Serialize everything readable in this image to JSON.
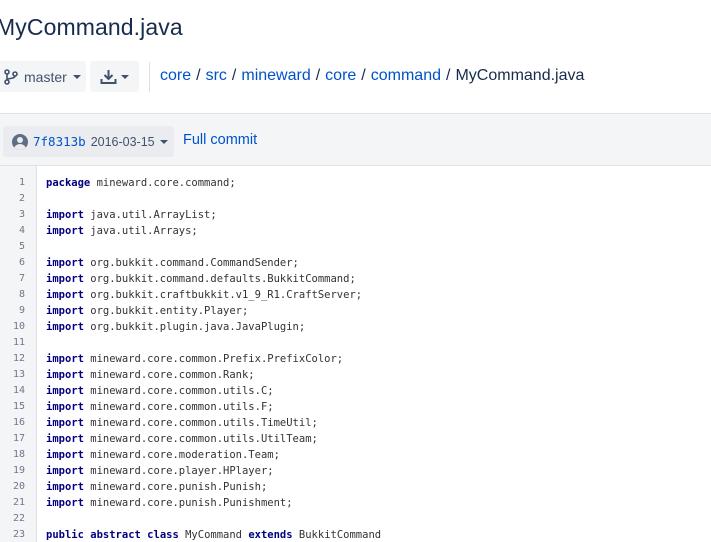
{
  "page": {
    "title": "MyCommand.java"
  },
  "toolbar": {
    "branch_label": "master",
    "branch_icon": "branch-icon",
    "download_icon": "download-icon"
  },
  "breadcrumb": {
    "parts": [
      "core",
      "src",
      "mineward",
      "core",
      "command"
    ],
    "current": "MyCommand.java"
  },
  "commit": {
    "hash": "7f8313b",
    "date": "2016-03-15",
    "full_commit_label": "Full commit"
  },
  "code": {
    "lines": [
      [
        {
          "t": "package",
          "k": 1
        },
        {
          "t": " mineward.core.command;"
        }
      ],
      [],
      [
        {
          "t": "import",
          "k": 1
        },
        {
          "t": " java.util.ArrayList;"
        }
      ],
      [
        {
          "t": "import",
          "k": 1
        },
        {
          "t": " java.util.Arrays;"
        }
      ],
      [],
      [
        {
          "t": "import",
          "k": 1
        },
        {
          "t": " org.bukkit.command.CommandSender;"
        }
      ],
      [
        {
          "t": "import",
          "k": 1
        },
        {
          "t": " org.bukkit.command.defaults.BukkitCommand;"
        }
      ],
      [
        {
          "t": "import",
          "k": 1
        },
        {
          "t": " org.bukkit.craftbukkit.v1_9_R1.CraftServer;"
        }
      ],
      [
        {
          "t": "import",
          "k": 1
        },
        {
          "t": " org.bukkit.entity.Player;"
        }
      ],
      [
        {
          "t": "import",
          "k": 1
        },
        {
          "t": " org.bukkit.plugin.java.JavaPlugin;"
        }
      ],
      [],
      [
        {
          "t": "import",
          "k": 1
        },
        {
          "t": " mineward.core.common.Prefix.PrefixColor;"
        }
      ],
      [
        {
          "t": "import",
          "k": 1
        },
        {
          "t": " mineward.core.common.Rank;"
        }
      ],
      [
        {
          "t": "import",
          "k": 1
        },
        {
          "t": " mineward.core.common.utils.C;"
        }
      ],
      [
        {
          "t": "import",
          "k": 1
        },
        {
          "t": " mineward.core.common.utils.F;"
        }
      ],
      [
        {
          "t": "import",
          "k": 1
        },
        {
          "t": " mineward.core.common.utils.TimeUtil;"
        }
      ],
      [
        {
          "t": "import",
          "k": 1
        },
        {
          "t": " mineward.core.common.utils.UtilTeam;"
        }
      ],
      [
        {
          "t": "import",
          "k": 1
        },
        {
          "t": " mineward.core.moderation.Team;"
        }
      ],
      [
        {
          "t": "import",
          "k": 1
        },
        {
          "t": " mineward.core.player.HPlayer;"
        }
      ],
      [
        {
          "t": "import",
          "k": 1
        },
        {
          "t": " mineward.core.punish.Punish;"
        }
      ],
      [
        {
          "t": "import",
          "k": 1
        },
        {
          "t": " mineward.core.punish.Punishment;"
        }
      ],
      [],
      [
        {
          "t": "public",
          "k": 1
        },
        {
          "t": " "
        },
        {
          "t": "abstract",
          "k": 1
        },
        {
          "t": " "
        },
        {
          "t": "class",
          "k": 1
        },
        {
          "t": " MyCommand "
        },
        {
          "t": "extends",
          "k": 1
        },
        {
          "t": " BukkitCommand"
        }
      ]
    ]
  }
}
